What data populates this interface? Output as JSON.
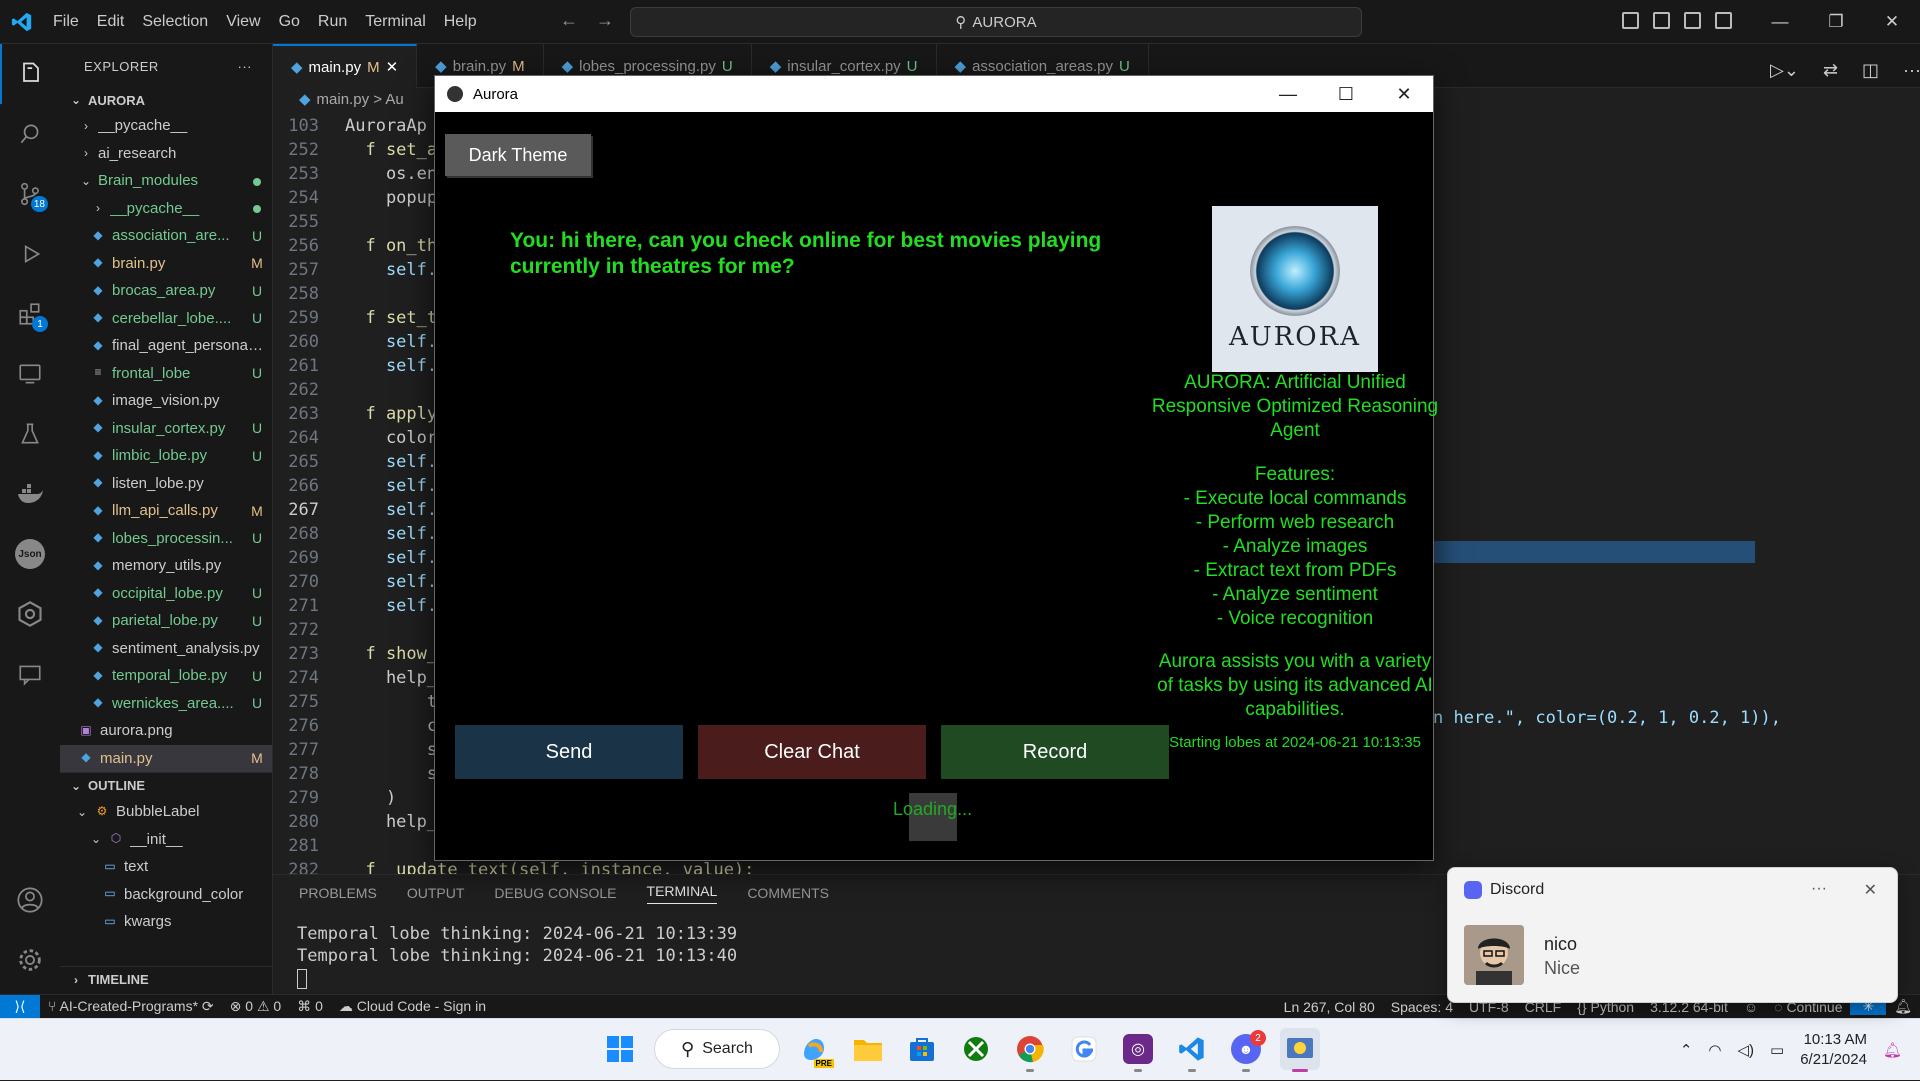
{
  "menu": [
    "File",
    "Edit",
    "Selection",
    "View",
    "Go",
    "Run",
    "Terminal",
    "Help"
  ],
  "search": {
    "label": "AURORA"
  },
  "explorer": {
    "title": "EXPLORER",
    "more": "···",
    "root": "AURORA"
  },
  "tree": [
    {
      "label": "__pycache__",
      "status": "",
      "indent": 1,
      "type": "folder",
      "chev": "›"
    },
    {
      "label": "ai_research",
      "status": "",
      "indent": 1,
      "type": "folder",
      "chev": "›"
    },
    {
      "label": "Brain_modules",
      "status": "dot",
      "indent": 1,
      "type": "folder-open",
      "chev": "⌄"
    },
    {
      "label": "__pycache__",
      "status": "dot",
      "indent": 2,
      "type": "folder",
      "chev": "›"
    },
    {
      "label": "association_are...",
      "status": "U",
      "indent": 2,
      "type": "py"
    },
    {
      "label": "brain.py",
      "status": "M",
      "indent": 2,
      "type": "py"
    },
    {
      "label": "brocas_area.py",
      "status": "U",
      "indent": 2,
      "type": "py"
    },
    {
      "label": "cerebellar_lobe....",
      "status": "U",
      "indent": 2,
      "type": "py"
    },
    {
      "label": "final_agent_persona.py",
      "status": "",
      "indent": 2,
      "type": "py"
    },
    {
      "label": "frontal_lobe",
      "status": "U",
      "indent": 2,
      "type": "txt"
    },
    {
      "label": "image_vision.py",
      "status": "",
      "indent": 2,
      "type": "py"
    },
    {
      "label": "insular_cortex.py",
      "status": "U",
      "indent": 2,
      "type": "py"
    },
    {
      "label": "limbic_lobe.py",
      "status": "U",
      "indent": 2,
      "type": "py"
    },
    {
      "label": "listen_lobe.py",
      "status": "",
      "indent": 2,
      "type": "py"
    },
    {
      "label": "llm_api_calls.py",
      "status": "M",
      "indent": 2,
      "type": "py"
    },
    {
      "label": "lobes_processin...",
      "status": "U",
      "indent": 2,
      "type": "py"
    },
    {
      "label": "memory_utils.py",
      "status": "",
      "indent": 2,
      "type": "py"
    },
    {
      "label": "occipital_lobe.py",
      "status": "U",
      "indent": 2,
      "type": "py"
    },
    {
      "label": "parietal_lobe.py",
      "status": "U",
      "indent": 2,
      "type": "py"
    },
    {
      "label": "sentiment_analysis.py",
      "status": "",
      "indent": 2,
      "type": "py"
    },
    {
      "label": "temporal_lobe.py",
      "status": "U",
      "indent": 2,
      "type": "py"
    },
    {
      "label": "wernickes_area....",
      "status": "U",
      "indent": 2,
      "type": "py"
    },
    {
      "label": "aurora.png",
      "status": "",
      "indent": 1,
      "type": "img"
    },
    {
      "label": "main.py",
      "status": "M",
      "indent": 1,
      "type": "py",
      "selected": true
    }
  ],
  "outline": {
    "title": "OUTLINE",
    "items": [
      {
        "label": "BubbleLabel",
        "indent": 1,
        "icon": "class"
      },
      {
        "label": "__init__",
        "indent": 2,
        "icon": "method"
      },
      {
        "label": "text",
        "indent": 3,
        "icon": "field"
      },
      {
        "label": "background_color",
        "indent": 3,
        "icon": "field"
      },
      {
        "label": "kwargs",
        "indent": 3,
        "icon": "field"
      }
    ]
  },
  "timeline": "TIMELINE",
  "tabs": [
    {
      "label": "main.py",
      "status": "M",
      "active": true
    },
    {
      "label": "brain.py",
      "status": "M"
    },
    {
      "label": "lobes_processing.py",
      "status": "U"
    },
    {
      "label": "insular_cortex.py",
      "status": "U"
    },
    {
      "label": "association_areas.py",
      "status": "U"
    }
  ],
  "breadcrumb": "main.py > Au",
  "code": [
    {
      "n": "103",
      "t": "AuroraAp"
    },
    {
      "n": "252",
      "t": "  f set_ap"
    },
    {
      "n": "253",
      "t": "    os.env"
    },
    {
      "n": "254",
      "t": "    popup."
    },
    {
      "n": "255",
      "t": ""
    },
    {
      "n": "256",
      "t": "  f on_the"
    },
    {
      "n": "257",
      "t": "    self.s"
    },
    {
      "n": "258",
      "t": ""
    },
    {
      "n": "259",
      "t": "  f set_th"
    },
    {
      "n": "260",
      "t": "    self.c"
    },
    {
      "n": "261",
      "t": "    self.a"
    },
    {
      "n": "262",
      "t": ""
    },
    {
      "n": "263",
      "t": "  f apply_"
    },
    {
      "n": "264",
      "t": "    colors"
    },
    {
      "n": "265",
      "t": "    self.r"
    },
    {
      "n": "266",
      "t": "    self.p"
    },
    {
      "n": "267",
      "t": "    self.p",
      "current": true
    },
    {
      "n": "268",
      "t": "    self.s"
    },
    {
      "n": "269",
      "t": "    self.s"
    },
    {
      "n": "270",
      "t": "    self.c"
    },
    {
      "n": "271",
      "t": "    self.r"
    },
    {
      "n": "272",
      "t": ""
    },
    {
      "n": "273",
      "t": "  f show_h"
    },
    {
      "n": "274",
      "t": "    help_p"
    },
    {
      "n": "275",
      "t": "        ti"
    },
    {
      "n": "276",
      "t": "        co"
    },
    {
      "n": "277",
      "t": "        si"
    },
    {
      "n": "278",
      "t": "        si"
    },
    {
      "n": "279",
      "t": "    )"
    },
    {
      "n": "280",
      "t": "    help_p"
    },
    {
      "n": "281",
      "t": ""
    },
    {
      "n": "282",
      "t": "  f  update_text(self, instance, value):"
    }
  ],
  "code_side": "n here.\", color=(0.2, 1, 0.2, 1)),",
  "panel": {
    "tabs": [
      "PROBLEMS",
      "OUTPUT",
      "DEBUG CONSOLE",
      "TERMINAL",
      "COMMENTS"
    ],
    "active": "TERMINAL",
    "lines": [
      "Temporal lobe thinking: 2024-06-21 10:13:39",
      "Temporal lobe thinking: 2024-06-21 10:13:40"
    ]
  },
  "status": {
    "branch": "AI-Created-Programs*",
    "errors": "0",
    "warnings": "0",
    "ports": "0",
    "cloud": "Cloud Code - Sign in",
    "position": "Ln 267, Col 80",
    "spaces": "Spaces: 4",
    "encoding": "UTF-8",
    "eol": "CRLF",
    "language": "Python",
    "interpreter": "3.12.2 64-bit",
    "continue": "Continue"
  },
  "aurora": {
    "title": "Aurora",
    "theme_button": "Dark Theme",
    "user_message": "You: hi there, can you check online for best movies playing currently in theatres for me?",
    "logo_word": "AURORA",
    "info_lines": [
      "AURORA: Artificial Unified",
      "Responsive Optimized Reasoning",
      "Agent",
      "",
      "Features:",
      "- Execute local commands",
      "- Perform web research",
      "- Analyze images",
      "- Extract text from PDFs",
      "- Analyze sentiment",
      "- Voice recognition",
      "",
      "Aurora assists you with a variety",
      "of tasks by using its advanced AI",
      "capabilities."
    ],
    "lobes_status": "Starting lobes at 2024-06-21 10:13:35",
    "send": "Send",
    "clear": "Clear Chat",
    "record": "Record",
    "loading": "Loading...",
    "colors": {
      "send": "#1a3346",
      "clear": "#4a1c1c",
      "record": "#1f4a22",
      "text": "#22dd22"
    }
  },
  "discord": {
    "app": "Discord",
    "more": "···",
    "name": "nico",
    "message": "Nice"
  },
  "taskbar": {
    "search": "Search",
    "time": "10:13 AM",
    "date": "6/21/2024",
    "discord_badge": "2",
    "copilot_badge": "PRE"
  },
  "activity": {
    "scm_badge": "18",
    "ext_badge": "1",
    "json": "Json"
  }
}
